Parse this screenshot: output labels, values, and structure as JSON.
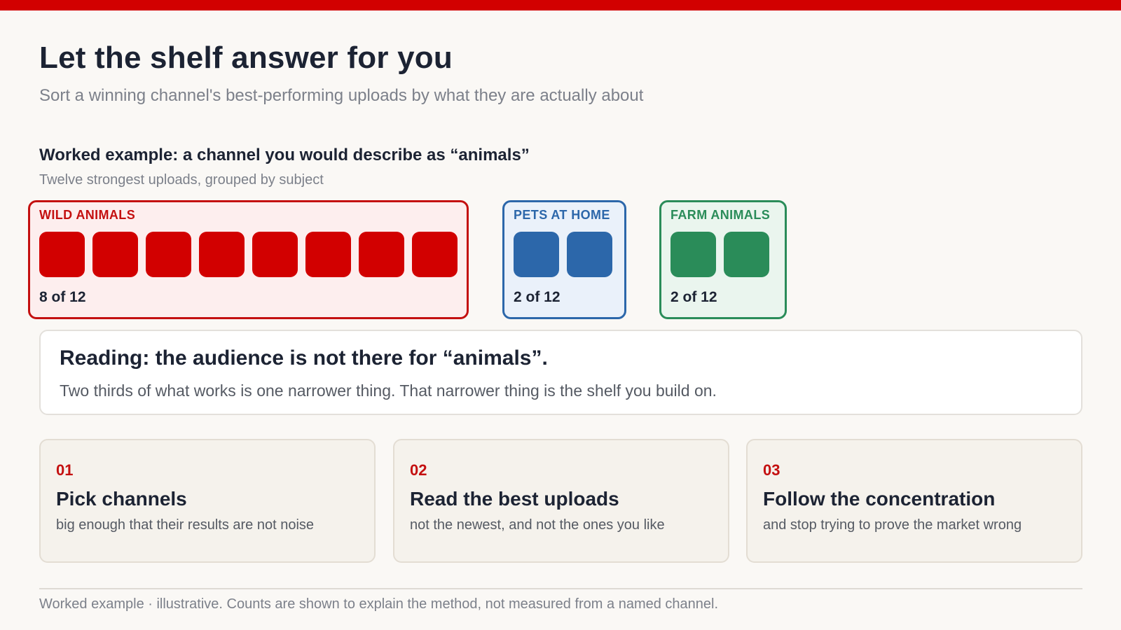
{
  "header": {
    "title": "Let the shelf answer for you",
    "subtitle": "Sort a winning channel's best-performing uploads by what they are actually about",
    "accent_color": "#d20000"
  },
  "example": {
    "title": "Worked example: a channel you would describe as “animals”",
    "subtitle": "Twelve strongest uploads, grouped by subject",
    "groups": [
      {
        "label": "WILD ANIMALS",
        "count": 8,
        "count_text": "8 of 12",
        "color": "#d20000"
      },
      {
        "label": "PETS AT HOME",
        "count": 2,
        "count_text": "2 of 12",
        "color": "#2c67aa"
      },
      {
        "label": "FARM ANIMALS",
        "count": 2,
        "count_text": "2 of 12",
        "color": "#2a8c59"
      }
    ]
  },
  "reading": {
    "title": "Reading: the audience is not there for “animals”.",
    "body": "Two thirds of what works is one narrower thing. That narrower thing is the shelf you build on."
  },
  "steps": [
    {
      "number": "01",
      "title": "Pick channels",
      "body": "big enough that their results are not noise"
    },
    {
      "number": "02",
      "title": "Read the best uploads",
      "body": "not the newest, and not the ones you like"
    },
    {
      "number": "03",
      "title": "Follow the concentration",
      "body": "and stop trying to prove the market wrong"
    }
  ],
  "footnote": "Worked example · illustrative. Counts are shown to explain the method, not measured from a named channel."
}
